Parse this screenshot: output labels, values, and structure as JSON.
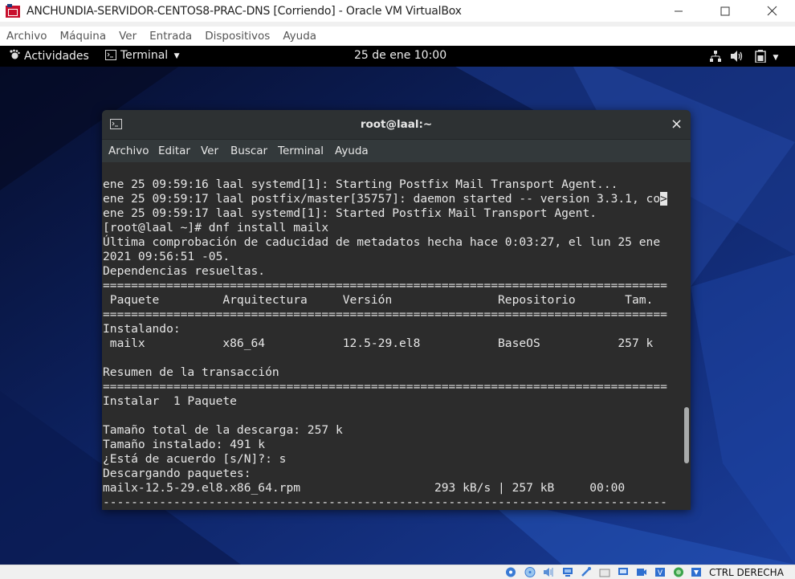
{
  "window": {
    "title": "ANCHUNDIA-SERVIDOR-CENTOS8-PRAC-DNS   [Corriendo] - Oracle VM VirtualBox",
    "minimize": "—",
    "maximize": "☐",
    "close": "✕"
  },
  "vb_menu": [
    "Archivo",
    "Máquina",
    "Ver",
    "Entrada",
    "Dispositivos",
    "Ayuda"
  ],
  "gnome": {
    "activities": "Actividades",
    "app_menu": "Terminal",
    "clock": "25 de ene  10:00"
  },
  "terminal": {
    "title": "root@laal:~",
    "close": "×",
    "menu": [
      "Archivo",
      "Editar",
      "Ver",
      "Buscar",
      "Terminal",
      "Ayuda"
    ],
    "lines": [
      "ene 25 09:59:16 laal systemd[1]: Starting Postfix Mail Transport Agent...",
      "ene 25 09:59:17 laal postfix/master[35757]: daemon started -- version 3.3.1, co",
      "ene 25 09:59:17 laal systemd[1]: Started Postfix Mail Transport Agent.",
      "[root@laal ~]# dnf install mailx",
      "Última comprobación de caducidad de metadatos hecha hace 0:03:27, el lun 25 ene",
      "2021 09:56:51 -05.",
      "Dependencias resueltas.",
      "================================================================================",
      " Paquete         Arquitectura     Versión               Repositorio       Tam.",
      "================================================================================",
      "Instalando:",
      " mailx           x86_64           12.5-29.el8           BaseOS           257 k",
      "",
      "Resumen de la transacción",
      "================================================================================",
      "Instalar  1 Paquete",
      "",
      "Tamaño total de la descarga: 257 k",
      "Tamaño instalado: 491 k",
      "¿Está de acuerdo [s/N]?: s",
      "Descargando paquetes:",
      "mailx-12.5-29.el8.x86_64.rpm                   293 kB/s | 257 kB     00:00",
      "--------------------------------------------------------------------------------"
    ],
    "cursor_char": ">"
  },
  "statusbar": {
    "host_key": "CTRL DERECHA"
  }
}
